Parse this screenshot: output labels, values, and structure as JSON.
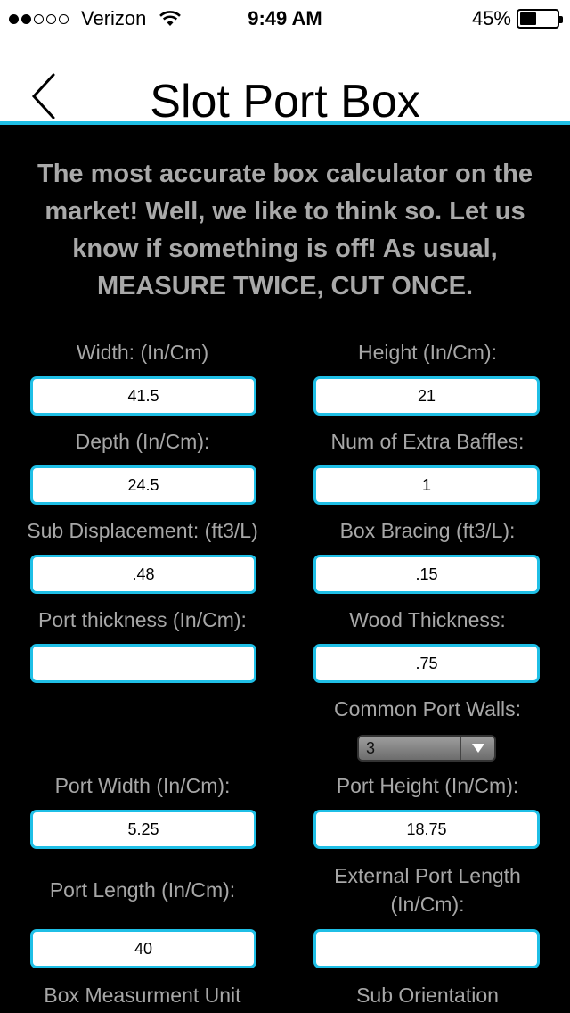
{
  "status": {
    "carrier": "Verizon",
    "time": "9:49 AM",
    "battery_text": "45%",
    "battery_level": 0.45
  },
  "nav": {
    "title": "Slot Port Box"
  },
  "intro": {
    "line1": "The most accurate box calculator on the",
    "line2": "market! Well, we like to think so. Let us",
    "line3": "know if something is off! As usual,",
    "line4": "MEASURE TWICE, CUT ONCE."
  },
  "fields": {
    "width": {
      "label": "Width: (In/Cm)",
      "value": "41.5"
    },
    "height": {
      "label": "Height (In/Cm):",
      "value": "21"
    },
    "depth": {
      "label": "Depth (In/Cm):",
      "value": "24.5"
    },
    "baffles": {
      "label": "Num of Extra Baffles:",
      "value": "1"
    },
    "sub_displacement": {
      "label": "Sub Displacement: (ft3/L)",
      "value": ".48"
    },
    "box_bracing": {
      "label": "Box Bracing (ft3/L):",
      "value": ".15"
    },
    "port_thickness": {
      "label": "Port thickness (In/Cm):",
      "value": ""
    },
    "wood_thickness": {
      "label": "Wood Thickness:",
      "value": ".75"
    },
    "port_width": {
      "label": "Port Width (In/Cm):",
      "value": "5.25"
    },
    "port_height": {
      "label": "Port Height (In/Cm):",
      "value": "18.75"
    },
    "port_length": {
      "label": "Port Length (In/Cm):",
      "value": "40"
    },
    "external_port_length": {
      "label_line1": "External Port Length",
      "label_line2": "(In/Cm):",
      "value": ""
    }
  },
  "common_port_walls": {
    "label": "Common Port Walls:",
    "selected": "3"
  },
  "bottom_labels": {
    "box_measurement_unit": "Box Measurment Unit",
    "sub_orientation": "Sub Orientation"
  },
  "colors": {
    "accent": "#1fbfe6",
    "label_text": "#a7a7a7",
    "background": "#000000"
  }
}
